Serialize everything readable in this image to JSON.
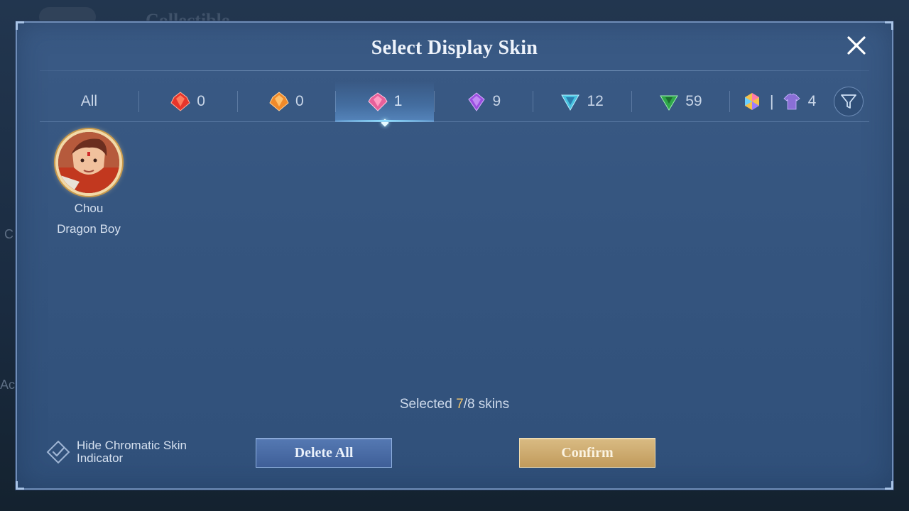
{
  "background": {
    "title": "Collectible"
  },
  "modal": {
    "title": "Select Display Skin"
  },
  "tabs": [
    {
      "id": "all",
      "label": "All",
      "icon": null,
      "active": false
    },
    {
      "id": "tier-red",
      "label": "0",
      "icon": "red-gem-icon",
      "color": "#e8352b",
      "active": false
    },
    {
      "id": "tier-orange",
      "label": "0",
      "icon": "orange-gem-icon",
      "color": "#f08a2a",
      "active": false
    },
    {
      "id": "tier-pink",
      "label": "1",
      "icon": "pink-gem-icon",
      "color": "#e8609a",
      "active": true
    },
    {
      "id": "tier-purple",
      "label": "9",
      "icon": "purple-gem-icon",
      "color": "#9b4fe0",
      "active": false
    },
    {
      "id": "tier-teal",
      "label": "12",
      "icon": "teal-gem-icon",
      "color": "#48c3e0",
      "active": false
    },
    {
      "id": "tier-green",
      "label": "59",
      "icon": "green-gem-icon",
      "color": "#2fa84a",
      "active": false
    },
    {
      "id": "tier-other",
      "label": "4",
      "icon": "hexagon-and-shirt-icon",
      "separator": "|",
      "active": false
    }
  ],
  "skins": [
    {
      "hero": "Chou",
      "name": "Dragon Boy"
    }
  ],
  "selection": {
    "prefix": "Selected ",
    "count": "7",
    "suffix": "/8 skins"
  },
  "hide_chromatic": {
    "label": "Hide Chromatic Skin Indicator"
  },
  "buttons": {
    "delete_all": "Delete All",
    "confirm": "Confirm"
  },
  "colors": {
    "accent_gold": "#f0c46a",
    "active_tab_glow": "#8fe0ff",
    "confirm_gold": "#c19b5c",
    "delete_blue": "#4a6ca6"
  }
}
